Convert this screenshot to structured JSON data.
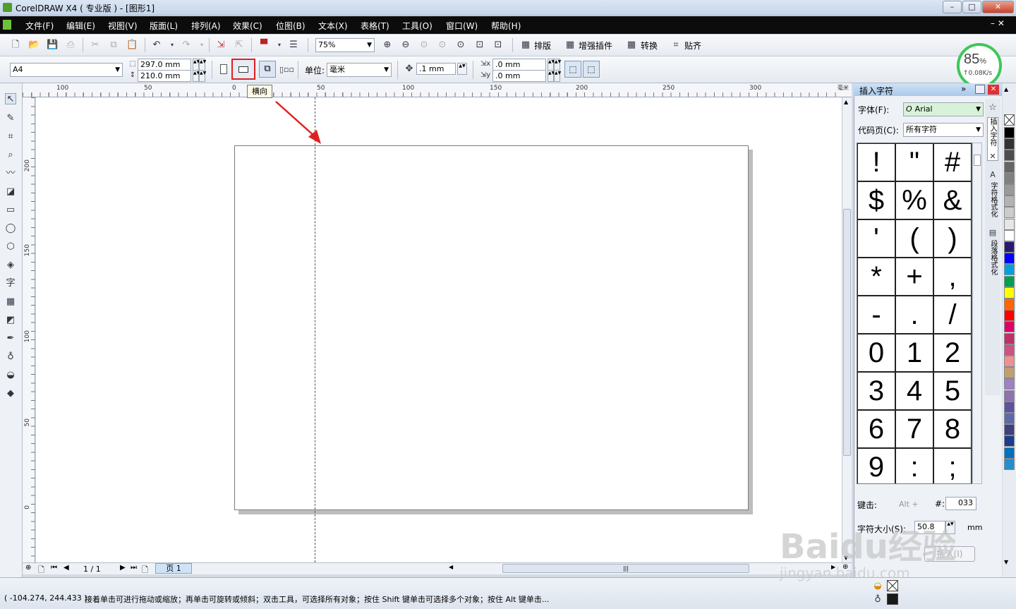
{
  "window": {
    "title": "CorelDRAW X4 ( 专业版 ) - [图形1]",
    "min": "–",
    "max": "□",
    "close": "✕"
  },
  "menu": [
    "文件(F)",
    "编辑(E)",
    "视图(V)",
    "版面(L)",
    "排列(A)",
    "效果(C)",
    "位图(B)",
    "文本(X)",
    "表格(T)",
    "工具(O)",
    "窗口(W)",
    "帮助(H)"
  ],
  "toolbar1": {
    "zoom": "75%",
    "plugins": [
      "排版",
      "增强插件",
      "转换",
      "贴齐"
    ]
  },
  "toolbar2": {
    "page_size": "A4",
    "width": "297.0 mm",
    "height": "210.0 mm",
    "unit_label": "单位:",
    "unit": "毫米",
    "nudge": ".1 mm",
    "dup_x": ".0 mm",
    "dup_y": ".0 mm",
    "tooltip": "横向"
  },
  "rulers": {
    "h": [
      "100",
      "50",
      "0",
      "50",
      "100",
      "150",
      "200",
      "250",
      "300"
    ],
    "v": [
      "200",
      "150",
      "100",
      "50",
      "0"
    ],
    "h_unit": "毫米"
  },
  "page_nav": {
    "counter": "1 / 1",
    "tab": "页 1"
  },
  "docker": {
    "title": "插入字符",
    "font_label": "字体(F):",
    "font": "Arial",
    "codepage_label": "代码页(C):",
    "codepage": "所有字符",
    "glyphs": [
      "!",
      "\"",
      "#",
      "$",
      "%",
      "&",
      "'",
      "(",
      ")",
      "*",
      "+",
      ",",
      "-",
      ".",
      "/",
      "0",
      "1",
      "2",
      "3",
      "4",
      "5",
      "6",
      "7",
      "8",
      "9",
      ":",
      ";"
    ],
    "keystroke_label": "键击:",
    "alt_label": "Alt +",
    "hash_label": "#:",
    "code": "033",
    "size_label": "字符大小(S):",
    "size": "50.8",
    "size_unit": "mm",
    "insert": "插入(I)",
    "side_tabs": [
      "插入字符",
      "字符格式化",
      "段落格式化"
    ]
  },
  "perf": {
    "percent": "85",
    "pct_sign": "%",
    "speed": "↑0.08K/s"
  },
  "status": {
    "coords": "( -104.274, 244.433 )",
    "hint": "接着单击可进行拖动或缩放；再单击可旋转或倾斜；双击工具，可选择所有对象；按住 Shift 键单击可选择多个对象；按住 Alt 键单击..."
  },
  "palette_colors": [
    "#000000",
    "#333333",
    "#4d4d4d",
    "#666666",
    "#808080",
    "#999999",
    "#b3b3b3",
    "#cccccc",
    "#e6e6e6",
    "#ffffff",
    "#2a1a6e",
    "#0000ff",
    "#00a0e0",
    "#00a050",
    "#ffff00",
    "#ff6600",
    "#ff0000",
    "#e0006a",
    "#c0306a",
    "#d05080",
    "#f09090",
    "#c0a070",
    "#a080c0",
    "#9070b0",
    "#6050a0",
    "#5c6aa8",
    "#404080",
    "#1e3c8c",
    "#0070c0",
    "#2090d0"
  ],
  "watermark": {
    "logo": "Baidu经验",
    "url": "jingyan.baidu.com"
  },
  "colors": {
    "accent_red": "#e02020",
    "menubar": "#0c0c0c",
    "perf_ring": "#3cc85a"
  }
}
